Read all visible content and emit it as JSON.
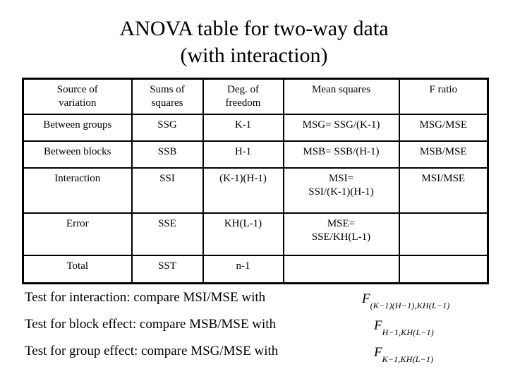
{
  "slide": {
    "title_line1": "ANOVA table for two-way data",
    "title_line2": "(with interaction)"
  },
  "table": {
    "headers": [
      {
        "line1": "Source of",
        "line2": "variation"
      },
      {
        "line1": "Sums of",
        "line2": "squares"
      },
      {
        "line1": "Deg. of",
        "line2": "freedom"
      },
      {
        "line1": "Mean squares",
        "line2": ""
      },
      {
        "line1": "F ratio",
        "line2": ""
      }
    ],
    "rows": [
      {
        "source": "Between groups",
        "ss": "SSG",
        "df": "K-1",
        "ms_line1": "MSG= SSG/(K-1)",
        "ms_line2": "",
        "f": "MSG/MSE"
      },
      {
        "source": "Between blocks",
        "ss": "SSB",
        "df": "H-1",
        "ms_line1": "MSB= SSB/(H-1)",
        "ms_line2": "",
        "f": "MSB/MSE"
      },
      {
        "source": "Interaction",
        "ss": "SSI",
        "df": "(K-1)(H-1)",
        "ms_line1": "MSI=",
        "ms_line2": "SSI/(K-1)(H-1)",
        "f": "MSI/MSE"
      },
      {
        "source": "Error",
        "ss": "SSE",
        "df": "KH(L-1)",
        "ms_line1": "MSE=",
        "ms_line2": "SSE/KH(L-1)",
        "f": ""
      },
      {
        "source": "Total",
        "ss": "SST",
        "df": "n-1",
        "ms_line1": "",
        "ms_line2": "",
        "f": ""
      }
    ]
  },
  "notes": [
    "Test for interaction: compare MSI/MSE with",
    "Test for block effect: compare MSB/MSE with",
    "Test for group effect: compare MSG/MSE with"
  ],
  "formulas": [
    {
      "symbol": "F",
      "subscript": "(K−1)(H−1),KH(L−1)"
    },
    {
      "symbol": "F",
      "subscript": "H−1,KH(L−1)"
    },
    {
      "symbol": "F",
      "subscript": "K−1,KH(L−1)"
    }
  ],
  "colors": {
    "background": "#ffffff",
    "text": "#000000",
    "border": "#000000"
  }
}
